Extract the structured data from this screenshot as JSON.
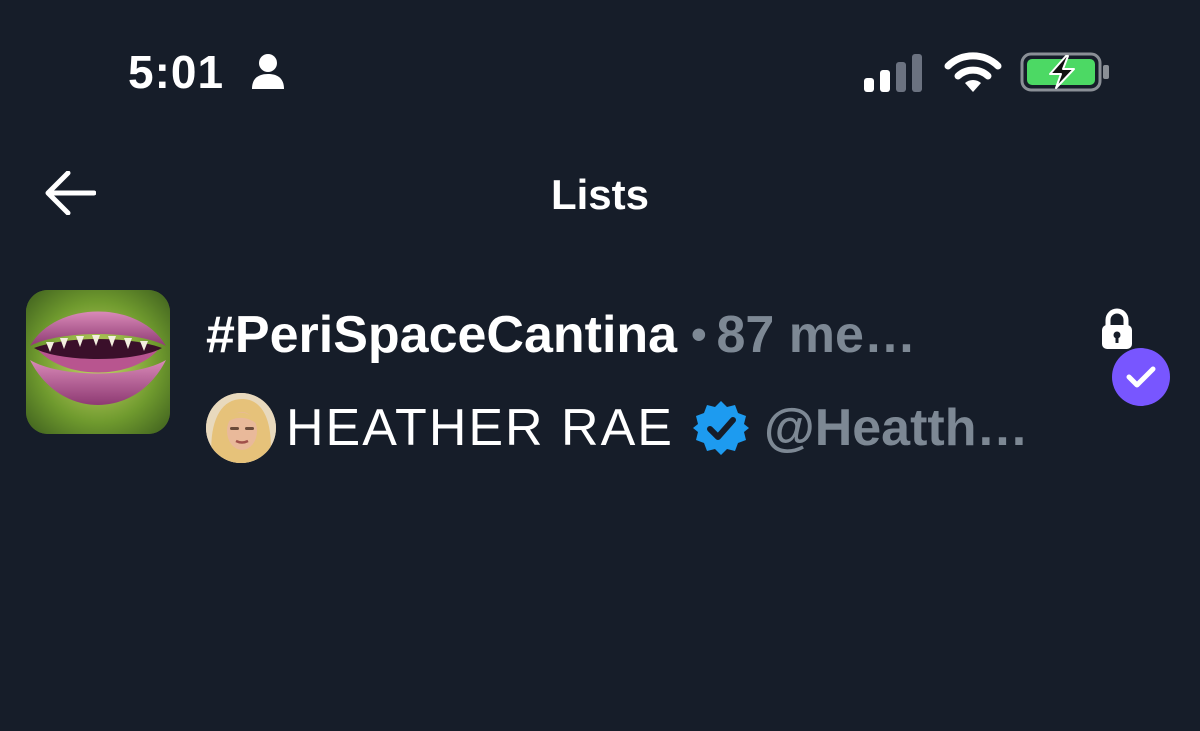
{
  "status_bar": {
    "time": "5:01",
    "icons": [
      "person-icon",
      "cellular-signal-icon",
      "wifi-icon",
      "battery-charging-icon"
    ]
  },
  "header": {
    "title": "Lists",
    "back_icon": "arrow-left-icon"
  },
  "lists": [
    {
      "name": "#PeriSpaceCantina",
      "separator": "•",
      "members": "87 me…",
      "private_icon": "lock-icon",
      "owner": {
        "display_name": "HEATHER RAE",
        "verified_icon": "verified-badge-icon",
        "handle": "@Heatth…"
      },
      "selected_icon": "checkmark-icon"
    }
  ],
  "colors": {
    "background": "#161d29",
    "text_primary": "#ffffff",
    "text_secondary": "#7d8894",
    "verified_blue": "#1d9bf0",
    "selected_purple": "#7856ff",
    "battery_green": "#4cd964"
  }
}
